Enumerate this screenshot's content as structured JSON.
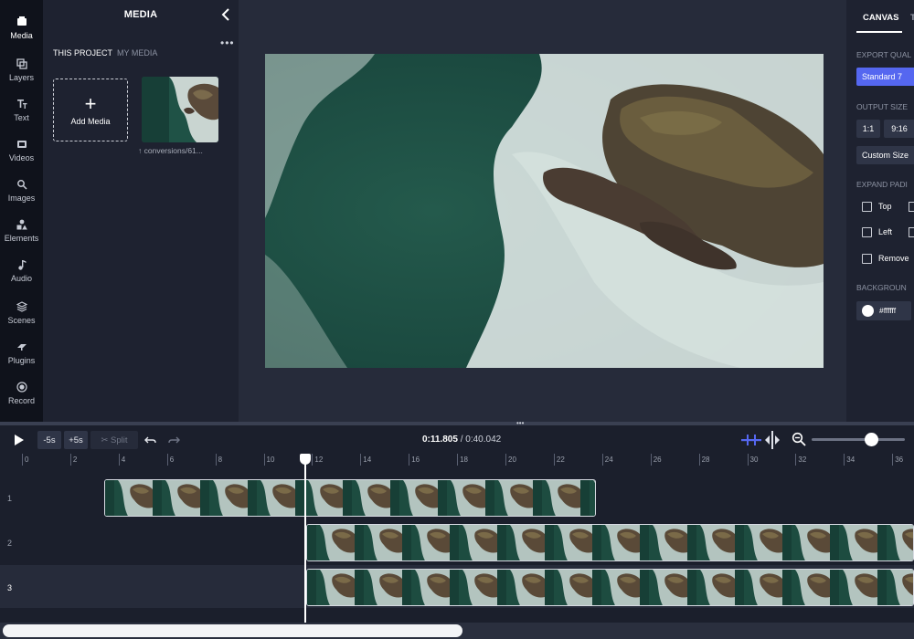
{
  "sidebar": {
    "items": [
      {
        "label": "Media",
        "icon": "media-icon",
        "active": true
      },
      {
        "label": "Layers",
        "icon": "layers-icon"
      },
      {
        "label": "Text",
        "icon": "text-icon"
      },
      {
        "label": "Videos",
        "icon": "videos-icon"
      },
      {
        "label": "Images",
        "icon": "images-icon"
      },
      {
        "label": "Elements",
        "icon": "elements-icon"
      },
      {
        "label": "Audio",
        "icon": "audio-icon"
      },
      {
        "label": "Scenes",
        "icon": "scenes-icon"
      },
      {
        "label": "Plugins",
        "icon": "plugins-icon"
      },
      {
        "label": "Record",
        "icon": "record-icon"
      }
    ]
  },
  "media_panel": {
    "title": "MEDIA",
    "more": "•••",
    "tabs": [
      "THIS PROJECT",
      "MY MEDIA"
    ],
    "add_media_plus": "+",
    "add_media_label": "Add Media",
    "thumb_caption": "↑ conversions/61..."
  },
  "right_panel": {
    "tabs": [
      "CANVAS",
      "T"
    ],
    "export_quality_label": "EXPORT QUAL",
    "quality_value": "Standard 7",
    "output_size_label": "OUTPUT SIZE",
    "sizes": [
      "1:1",
      "9:16"
    ],
    "custom_size": "Custom Size",
    "expand_padding_label": "EXPAND PADI",
    "padding_options": [
      "Top",
      "Left",
      "Remove"
    ],
    "background_label": "BACKGROUN",
    "background_value": "#ffffff"
  },
  "divider_handle": "•••",
  "timeline": {
    "back_label": "-5s",
    "fwd_label": "+5s",
    "split_label": "✂ Split",
    "current_time": "0:11.805",
    "separator": " / ",
    "total_time": "0:40.042",
    "ruler_ticks": [
      "0",
      "2",
      "4",
      "6",
      "8",
      "10",
      "12",
      "14",
      "16",
      "18",
      "20",
      "22",
      "24",
      "26",
      "28",
      "30",
      "32",
      "34",
      "36"
    ],
    "rows": [
      "1",
      "2",
      "3"
    ]
  },
  "colors": {
    "accent": "#5567f0",
    "rail_bg": "#0f121b",
    "panel_bg": "#1e2230",
    "preview_bg": "#262b3a"
  }
}
